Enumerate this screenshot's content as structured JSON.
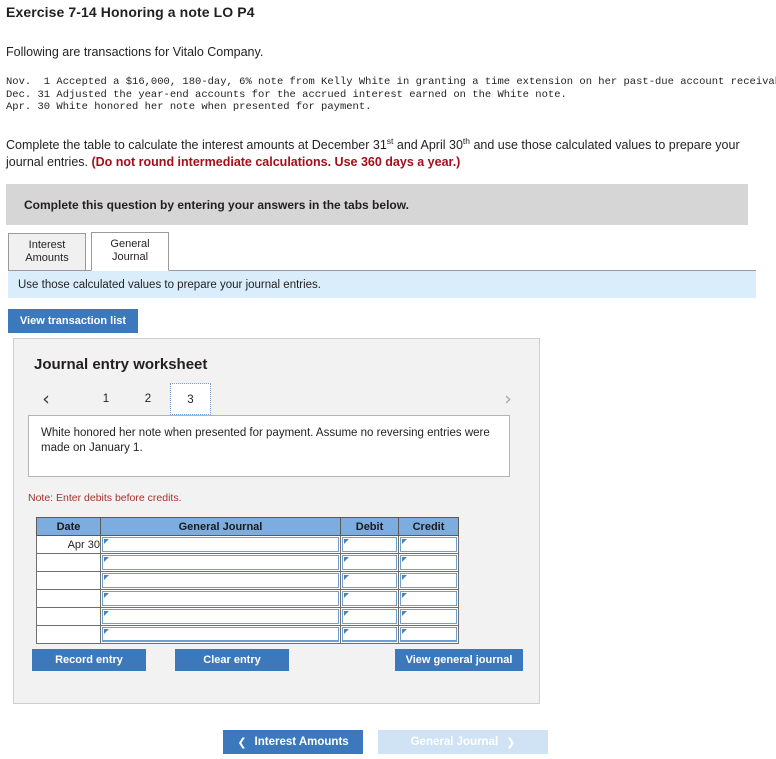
{
  "exercise": {
    "title": "Exercise 7-14 Honoring a note LO P4",
    "intro": "Following are transactions for Vitalo Company.",
    "transactions_text": "Nov.  1 Accepted a $16,000, 180-day, 6% note from Kelly White in granting a time extension on her past-due account receivable.\nDec. 31 Adjusted the year-end accounts for the accrued interest earned on the White note.\nApr. 30 White honored her note when presented for payment.",
    "instruction_part1": "Complete the table to calculate the interest amounts at December 31",
    "instruction_sup1": "st",
    "instruction_part2": " and April 30",
    "instruction_sup2": "th",
    "instruction_part3": " and use those calculated values to prepare your journal entries. ",
    "instruction_red": "(Do not round intermediate calculations. Use 360 days a year.)"
  },
  "banner": {
    "text": "Complete this question by entering your answers in the tabs below."
  },
  "tabs": [
    {
      "label_line1": "Interest",
      "label_line2": "Amounts",
      "active": false
    },
    {
      "label_line1": "General",
      "label_line2": "Journal",
      "active": true
    }
  ],
  "info_bar": {
    "text": "Use those calculated values to prepare your journal entries."
  },
  "buttons": {
    "view_transaction_list": "View transaction list",
    "record_entry": "Record entry",
    "clear_entry": "Clear entry",
    "view_general_journal": "View general journal"
  },
  "worksheet": {
    "title": "Journal entry worksheet",
    "pager": {
      "prev_icon": "chevron-left",
      "next_icon": "chevron-right",
      "pages": [
        "1",
        "2",
        "3"
      ],
      "selected": "3"
    },
    "description": "White honored her note when presented for payment. Assume no reversing entries were made on January 1.",
    "note": "Note: Enter debits before credits.",
    "table": {
      "headers": [
        "Date",
        "General Journal",
        "Debit",
        "Credit"
      ],
      "rows": [
        {
          "date": "Apr 30",
          "general_journal": "",
          "debit": "",
          "credit": ""
        },
        {
          "date": "",
          "general_journal": "",
          "debit": "",
          "credit": ""
        },
        {
          "date": "",
          "general_journal": "",
          "debit": "",
          "credit": ""
        },
        {
          "date": "",
          "general_journal": "",
          "debit": "",
          "credit": ""
        },
        {
          "date": "",
          "general_journal": "",
          "debit": "",
          "credit": ""
        },
        {
          "date": "",
          "general_journal": "",
          "debit": "",
          "credit": ""
        }
      ]
    }
  },
  "bottom_nav": {
    "prev_label": "Interest Amounts",
    "prev_icon": "chevron-left",
    "next_label": "General Journal",
    "next_icon": "chevron-right",
    "next_disabled": true
  },
  "colors": {
    "accent_blue": "#3b78bc",
    "table_header_blue": "#7dadde",
    "info_bar_blue": "#d9edfb",
    "banner_grey": "#d6d6d6",
    "alert_red": "#a50d1a"
  }
}
